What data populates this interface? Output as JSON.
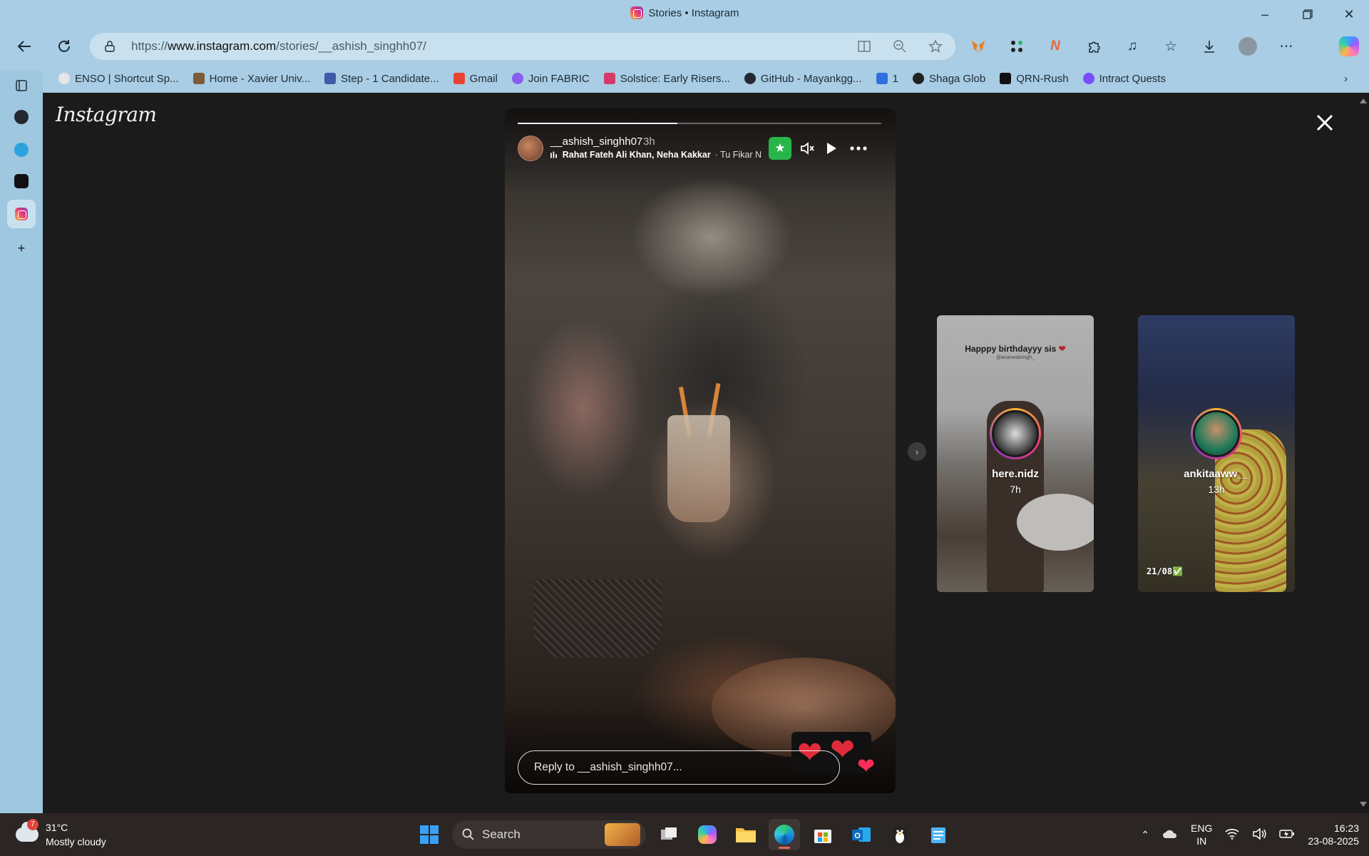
{
  "window": {
    "title": "Stories • Instagram"
  },
  "address_bar": {
    "url_prefix": "https://",
    "url_host": "www.instagram.com",
    "url_path": "/stories/__ashish_singhh07/"
  },
  "bookmarks": [
    {
      "label": "ENSO | Shortcut Sp...",
      "color": "#e6e6e6"
    },
    {
      "label": "Home - Xavier Univ...",
      "color": "#7c5a3a"
    },
    {
      "label": "Step - 1 Candidate...",
      "color": "#3f5aa8"
    },
    {
      "label": "Gmail",
      "color": "#ea4335"
    },
    {
      "label": "Join FABRIC",
      "color": "#8a5cf0"
    },
    {
      "label": "Solstice: Early Risers...",
      "color": "#d63a6a"
    },
    {
      "label": "GitHub - Mayankgg...",
      "color": "#24292f"
    },
    {
      "label": "1",
      "color": "#2f6fe0"
    },
    {
      "label": "Shaga Glob",
      "color": "#222222"
    },
    {
      "label": "QRN-Rush",
      "color": "#111111"
    },
    {
      "label": "Intract Quests",
      "color": "#7c4dff"
    }
  ],
  "page": {
    "logo": "Instagram",
    "story": {
      "username": "__ashish_singhh07",
      "time": "3h",
      "music_artists": "Rahat Fateh Ali Khan, Neha Kakkar",
      "music_song": " · Tu Fikar N",
      "progress": 0.44,
      "reply_placeholder": "Reply to __ashish_singhh07..."
    },
    "previews": [
      {
        "name": "here.nidz",
        "time": "7h",
        "caption": "Happpy birthdayyy sis",
        "caption_sub": "@ananwalsingh_"
      },
      {
        "name": "ankitaaww__",
        "time": "13h",
        "tag": "21/08✅"
      }
    ]
  },
  "taskbar": {
    "weather_temp": "31°C",
    "weather_desc": "Mostly cloudy",
    "weather_badge": "7",
    "search_label": "Search",
    "lang_top": "ENG",
    "lang_bottom": "IN",
    "time": "16:23",
    "date": "23-08-2025"
  },
  "colors": {
    "accent_green": "#27b64a",
    "like_red": "#ff2d55",
    "page_bg": "#1b1b1b"
  }
}
